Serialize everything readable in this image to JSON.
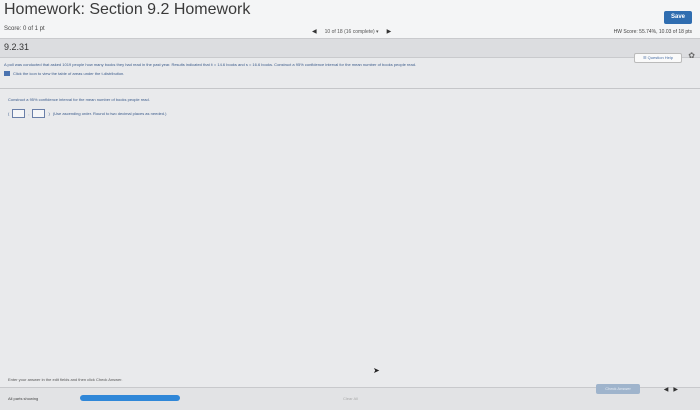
{
  "header": {
    "title": "Homework: Section 9.2 Homework",
    "save": "Save",
    "score": "Score: 0 of 1 pt",
    "nav_text": "10 of 18 (16 complete)",
    "hw_score": "HW Score: 55.74%, 10.03 of 18 pts"
  },
  "question": {
    "number": "9.2.31",
    "help": "Question Help",
    "text": "A poll was conducted that asked 1019 people how many books they had read in the past year. Results indicated that x̄ = 14.6 books and s = 16.6 books. Construct a 95% confidence interval for the mean number of books people read.",
    "tip": "Click the icon to view the table of areas under the t-distribution.",
    "prompt": "Construct a 95% confidence interval for the mean number of books people read.",
    "answer_hint": "(Use ascending order. Round to two decimal places as needed.)"
  },
  "footer": {
    "instructions": "Enter your answer in the edit fields and then click Check Answer.",
    "parts": "All parts showing",
    "progress": 1.0,
    "clear_all": "Clear All",
    "check": "Check Answer"
  }
}
